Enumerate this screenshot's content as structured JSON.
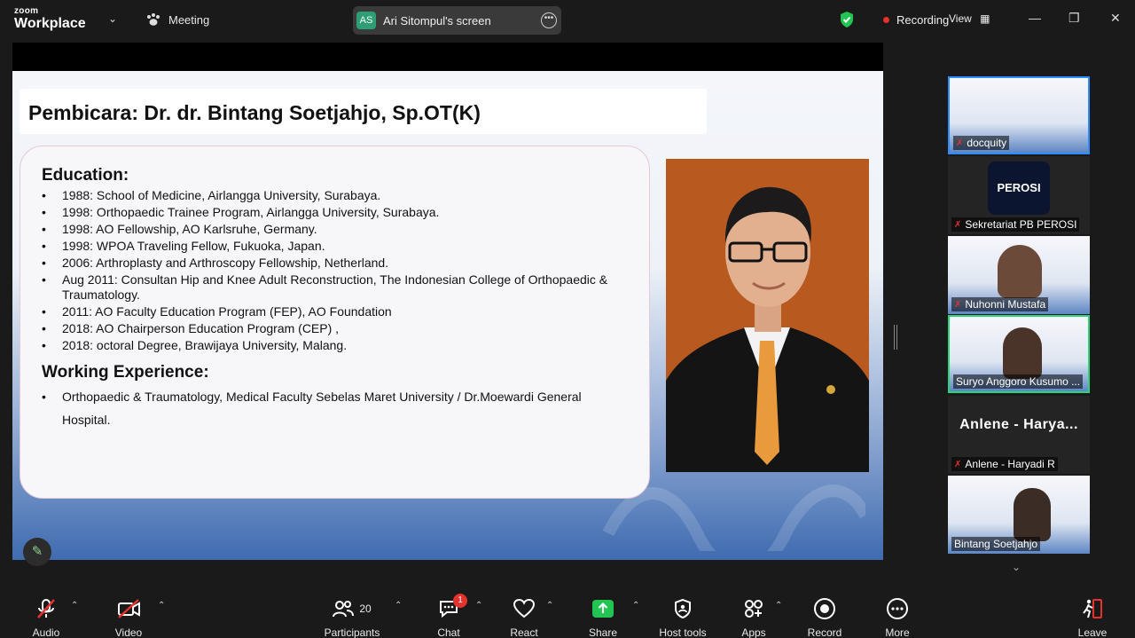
{
  "app": {
    "brand_line1": "zoom",
    "brand_line2": "Workplace",
    "meeting_label": "Meeting"
  },
  "share_pill": {
    "initials": "AS",
    "label": "Ari Sitompul's screen"
  },
  "status": {
    "recording": "Recording",
    "view": "View"
  },
  "slide": {
    "title": "Pembicara: Dr. dr. Bintang Soetjahjo, Sp.OT(K)",
    "education_heading": "Education:",
    "education": [
      "1988: School of Medicine, Airlangga University, Surabaya.",
      "1998: Orthopaedic Trainee Program, Airlangga University, Surabaya.",
      "1998: AO Fellowship, AO Karlsruhe, Germany.",
      "1998: WPOA Traveling Fellow, Fukuoka, Japan.",
      "2006: Arthroplasty and Arthroscopy Fellowship, Netherland.",
      "Aug 2011: Consultan Hip and Knee Adult Reconstruction, The Indonesian College of Orthopaedic & Traumatology.",
      "2011: AO Faculty Education Program (FEP), AO Foundation",
      "2018: AO Chairperson Education Program (CEP) ,",
      "2018: octoral Degree, Brawijaya University, Malang."
    ],
    "work_heading": "Working Experience:",
    "work_line1": "Orthopaedic & Traumatology, Medical Faculty Sebelas Maret University / Dr.Moewardi General",
    "work_line2": "Hospital.",
    "bullet": "•"
  },
  "participants": [
    {
      "name": "docquity"
    },
    {
      "name": "Sekretariat PB PEROSI",
      "logo_text": "PEROSI"
    },
    {
      "name": "Nuhonni Mustafa"
    },
    {
      "name": "Suryo Anggoro Kusumo ..."
    },
    {
      "name": "Anlene - Haryadi R",
      "big_name": "Anlene - Harya..."
    },
    {
      "name": "Bintang Soetjahjo"
    }
  ],
  "toolbar": {
    "audio": "Audio",
    "video": "Video",
    "participants": "Participants",
    "participants_count": "20",
    "chat": "Chat",
    "chat_badge": "1",
    "react": "React",
    "share": "Share",
    "host_tools": "Host tools",
    "apps": "Apps",
    "record": "Record",
    "more": "More",
    "leave": "Leave"
  },
  "colors": {
    "accent_green": "#2bd67b",
    "record_red": "#e5322d",
    "share_green": "#23c552",
    "brand_blue": "#2d8cff"
  }
}
